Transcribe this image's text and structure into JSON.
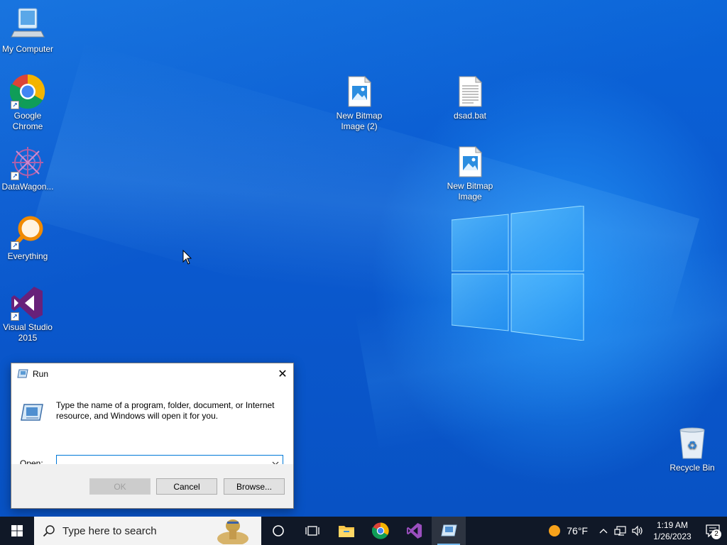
{
  "desktop_icons": {
    "my_computer": "My Computer",
    "chrome": "Google Chrome",
    "datawagon": "DataWagon...",
    "everything": "Everything",
    "visual_studio": "Visual Studio 2015",
    "bitmap2": "New Bitmap Image (2)",
    "dsad": "dsad.bat",
    "bitmap": "New Bitmap Image",
    "recycle_bin": "Recycle Bin"
  },
  "run_dialog": {
    "title": "Run",
    "description": "Type the name of a program, folder, document, or Internet resource, and Windows will open it for you.",
    "open_label": "Open:",
    "open_value": "",
    "ok_label": "OK",
    "cancel_label": "Cancel",
    "browse_label": "Browse..."
  },
  "taskbar": {
    "search_placeholder": "Type here to search",
    "weather": "76°F",
    "time": "1:19 AM",
    "date": "1/26/2023",
    "notification_count": "2",
    "pinned": [
      "cortana-icon",
      "task-view-icon",
      "file-explorer-icon",
      "chrome-icon",
      "visual-studio-icon",
      "run-icon"
    ]
  },
  "colors": {
    "accent": "#0078d7",
    "taskbar": "#101827",
    "wallpaper": "#0a5cd6"
  }
}
